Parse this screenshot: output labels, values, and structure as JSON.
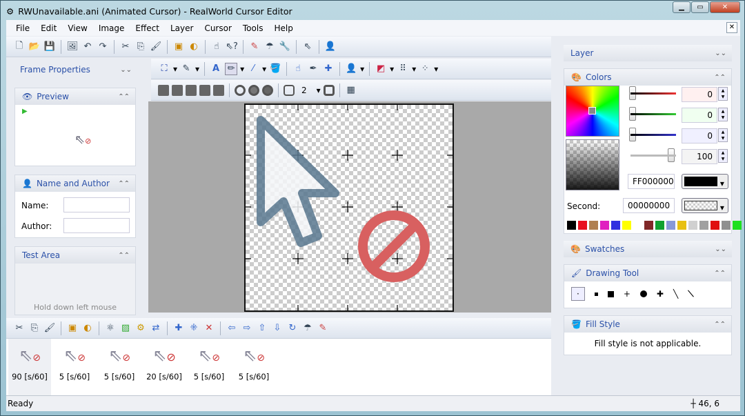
{
  "window": {
    "title": "RWUnavailable.ani (Animated Cursor) - RealWorld Cursor Editor"
  },
  "menu": [
    "File",
    "Edit",
    "View",
    "Image",
    "Effect",
    "Layer",
    "Cursor",
    "Tools",
    "Help"
  ],
  "left": {
    "frame_properties": "Frame Properties",
    "preview": "Preview",
    "name_author": {
      "title": "Name and Author",
      "name_label": "Name:",
      "name_value": "",
      "author_label": "Author:",
      "author_value": ""
    },
    "test_area": {
      "title": "Test Area",
      "hint": "Hold down left mouse button and move the mouse to test cursor hot"
    }
  },
  "toolbar": {
    "line_width": "2"
  },
  "right": {
    "layer": "Layer",
    "colors": {
      "title": "Colors",
      "red": "0",
      "green": "0",
      "blue": "0",
      "alpha": "100",
      "hex": "FF000000",
      "second_label": "Second:",
      "second_hex": "00000000",
      "palette": [
        "#000000",
        "#e81020",
        "#b08050",
        "#e020c0",
        "#3030e0",
        "#ffff00",
        "#ffffff",
        "#802828",
        "#10a030",
        "#8898d8",
        "#e8c010",
        "#d0d0d0",
        "#a0a0a0",
        "#e01010",
        "#909090",
        "#20e020"
      ]
    },
    "swatches": "Swatches",
    "drawing_tool": "Drawing Tool",
    "fill_style": {
      "title": "Fill Style",
      "message": "Fill style is not applicable."
    }
  },
  "frames": [
    {
      "delay": "90 [s/60]"
    },
    {
      "delay": "5 [s/60]"
    },
    {
      "delay": "5 [s/60]"
    },
    {
      "delay": "20 [s/60]"
    },
    {
      "delay": "5 [s/60]"
    },
    {
      "delay": "5 [s/60]"
    }
  ],
  "status": {
    "text": "Ready",
    "coords": "46, 6"
  }
}
